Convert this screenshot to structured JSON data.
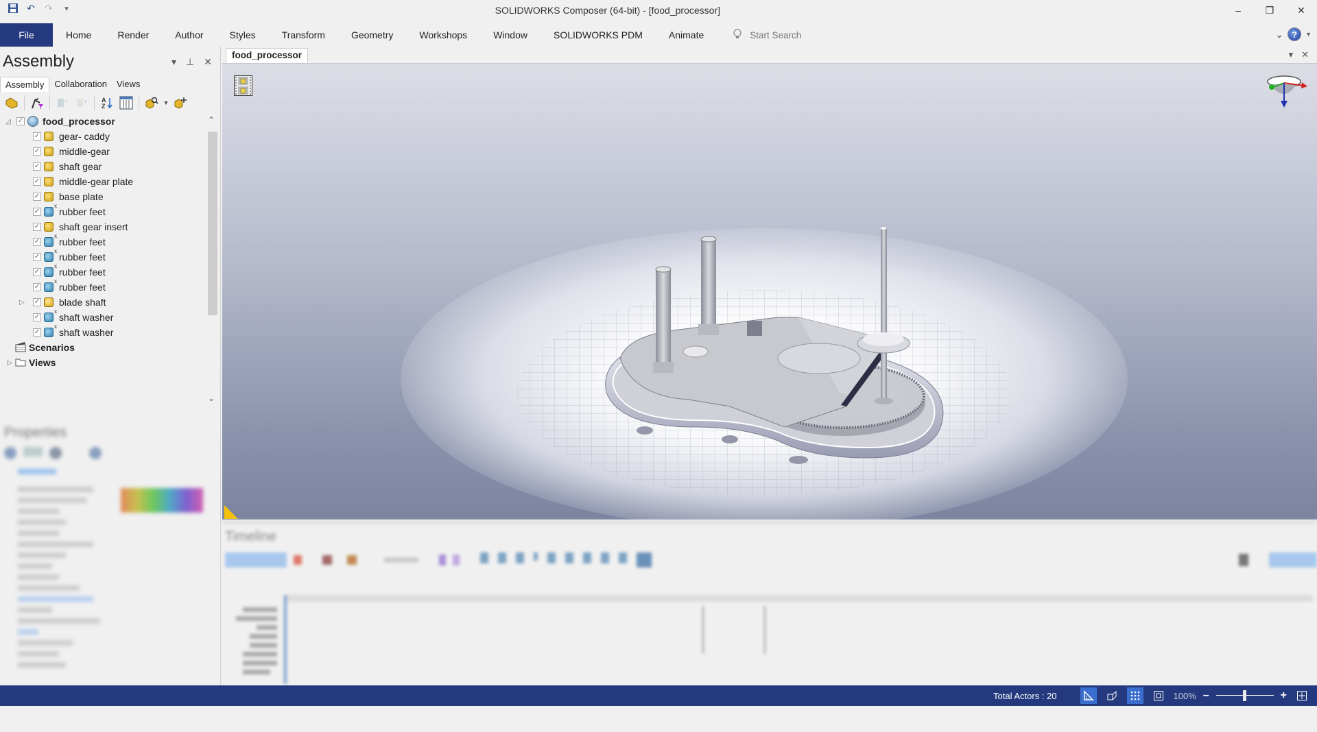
{
  "titlebar": {
    "app_title": "SOLIDWORKS Composer (64-bit) - [food_processor]",
    "quick_access": [
      {
        "name": "save-icon",
        "glyph": "🖫"
      },
      {
        "name": "undo-icon",
        "glyph": "↶"
      },
      {
        "name": "redo-icon",
        "glyph": "↷"
      },
      {
        "name": "customize-qat-icon",
        "glyph": "▾"
      }
    ],
    "window_controls": {
      "minimize": "–",
      "restore": "❐",
      "close": "✕"
    }
  },
  "ribbon": {
    "tabs": [
      "File",
      "Home",
      "Render",
      "Author",
      "Styles",
      "Transform",
      "Geometry",
      "Workshops",
      "Window",
      "SOLIDWORKS PDM",
      "Animate"
    ],
    "search_placeholder": "Start Search",
    "help_glyph": "?",
    "collapse_glyph": "⌄"
  },
  "assembly_panel": {
    "title": "Assembly",
    "header_controls": {
      "menu": "▾",
      "pin": "⊥",
      "close": "✕"
    },
    "tabs": [
      {
        "label": "Assembly",
        "active": true
      },
      {
        "label": "Collaboration",
        "active": false
      },
      {
        "label": "Views",
        "active": false
      }
    ],
    "toolbar_icons": [
      {
        "name": "select-mode-icon",
        "glyph": "⛶"
      },
      {
        "name": "filter-icon",
        "glyph": "⚙"
      },
      {
        "name": "add-group-icon",
        "glyph": "⊞"
      },
      {
        "name": "add-item-icon",
        "glyph": "⊞"
      },
      {
        "name": "sort-az-icon",
        "glyph": "⇣"
      },
      {
        "name": "columns-icon",
        "glyph": "▦"
      },
      {
        "name": "search-actor-icon",
        "glyph": "🔍"
      },
      {
        "name": "dropdown-icon",
        "glyph": "▾"
      },
      {
        "name": "pick-actor-icon",
        "glyph": "⌖"
      }
    ],
    "tree": {
      "root": "food_processor",
      "items": [
        {
          "label": "gear- caddy",
          "type": "part",
          "checked": true
        },
        {
          "label": "middle-gear",
          "type": "part",
          "checked": true
        },
        {
          "label": "shaft gear",
          "type": "part",
          "checked": true
        },
        {
          "label": "middle-gear plate",
          "type": "part",
          "checked": true
        },
        {
          "label": "base plate",
          "type": "part",
          "checked": true
        },
        {
          "label": "rubber feet",
          "type": "component",
          "checked": true
        },
        {
          "label": "shaft gear insert",
          "type": "part",
          "checked": true
        },
        {
          "label": "rubber feet",
          "type": "component",
          "checked": true
        },
        {
          "label": "rubber feet",
          "type": "component",
          "checked": true
        },
        {
          "label": "rubber feet",
          "type": "component",
          "checked": true
        },
        {
          "label": "rubber feet",
          "type": "component",
          "checked": true
        },
        {
          "label": "blade shaft",
          "type": "assembly",
          "checked": true,
          "expandable": true
        },
        {
          "label": "shaft washer",
          "type": "component",
          "checked": true
        },
        {
          "label": "shaft washer",
          "type": "component",
          "checked": true
        }
      ],
      "sections": [
        "Scenarios",
        "Views"
      ]
    }
  },
  "properties_panel": {
    "title": "Properties"
  },
  "document": {
    "tab_label": "food_processor",
    "tab_controls": {
      "menu": "▾",
      "close": "✕"
    }
  },
  "timeline_panel": {
    "title": "Timeline"
  },
  "statusbar": {
    "total_actors": "Total Actors : 20",
    "zoom_level": "100%",
    "zoom_minus": "–",
    "zoom_plus": "+",
    "zoom_slider_fraction": 0.5,
    "icons": [
      {
        "name": "measure-icon",
        "glyph": "📐",
        "active": true
      },
      {
        "name": "perspective-icon",
        "glyph": "◩",
        "active": false
      },
      {
        "name": "grid-icon",
        "glyph": "⋮⋮",
        "active": true
      },
      {
        "name": "fit-icon",
        "glyph": "⊡",
        "active": false
      }
    ],
    "fullscreen_glyph": "⛶"
  },
  "colors": {
    "brand_blue": "#24397e",
    "part_yellow": "#e6b422",
    "component_blue": "#2f7fae",
    "viewport_top": "#dcdee6",
    "viewport_bottom": "#7c84a0"
  }
}
